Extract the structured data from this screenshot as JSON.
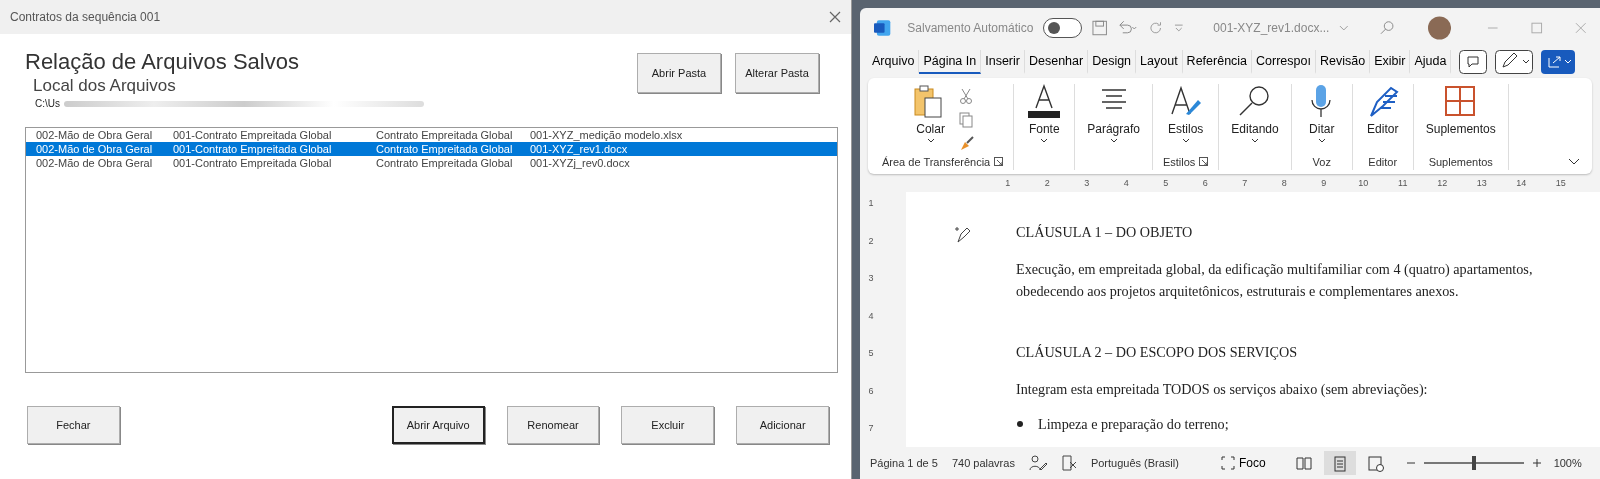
{
  "dialog": {
    "title": "Contratos da sequência 001",
    "heading": "Relação de Arquivos Salvos",
    "subheading": "Local dos Arquivos",
    "path": "C:\\Us",
    "top_buttons": [
      "Abrir Pasta",
      "Alterar Pasta"
    ],
    "files": [
      {
        "cells": [
          "002-Mão de Obra Geral",
          "001-Contrato Empreitada Global",
          "Contrato Empreitada Global",
          "001-XYZ_medição modelo.xlsx"
        ],
        "selected": false
      },
      {
        "cells": [
          "002-Mão de Obra Geral",
          "001-Contrato Empreitada Global",
          "Contrato Empreitada Global",
          "001-XYZ_rev1.docx"
        ],
        "selected": true
      },
      {
        "cells": [
          "002-Mão de Obra Geral",
          "001-Contrato Empreitada Global",
          "Contrato Empreitada Global",
          "001-XYZj_rev0.docx"
        ],
        "selected": false
      }
    ],
    "bottom_buttons": [
      {
        "label": "Fechar",
        "focused": false
      },
      {
        "label": "Abrir Arquivo",
        "focused": true
      },
      {
        "label": "Renomear",
        "focused": false
      },
      {
        "label": "Excluir",
        "focused": false
      },
      {
        "label": "Adicionar",
        "focused": false
      }
    ]
  },
  "word": {
    "autosave_label": "Salvamento Automático",
    "autosave_on": false,
    "doc_title": "001-XYZ_rev1.docx...",
    "tabs": [
      {
        "label": "Arquivo",
        "selected": false
      },
      {
        "label": "Página In",
        "selected": true
      },
      {
        "label": "Inserir",
        "selected": false
      },
      {
        "label": "Desenhar",
        "selected": false
      },
      {
        "label": "Design",
        "selected": false
      },
      {
        "label": "Layout",
        "selected": false
      },
      {
        "label": "Referência",
        "selected": false
      },
      {
        "label": "Correspoı",
        "selected": false
      },
      {
        "label": "Revisão",
        "selected": false
      },
      {
        "label": "Exibir",
        "selected": false
      },
      {
        "label": "Ajuda",
        "selected": false
      }
    ],
    "ribbon_groups": [
      {
        "label": "Área de Transferência",
        "launcher": true,
        "buttons": [
          {
            "label": "Colar",
            "kind": "paste",
            "dropdown": true
          }
        ]
      },
      {
        "buttons": [
          {
            "label": "Fonte",
            "kind": "font",
            "dropdown": true
          }
        ]
      },
      {
        "buttons": [
          {
            "label": "Parágrafo",
            "kind": "paragraph",
            "dropdown": true
          }
        ]
      },
      {
        "label": "Estilos",
        "launcher": true,
        "buttons": [
          {
            "label": "Estilos",
            "kind": "styles",
            "dropdown": true
          }
        ]
      },
      {
        "buttons": [
          {
            "label": "Editando",
            "kind": "search",
            "dropdown": true
          }
        ]
      },
      {
        "label": "Voz",
        "launcher": false,
        "buttons": [
          {
            "label": "Ditar",
            "kind": "mic",
            "dropdown": true
          }
        ]
      },
      {
        "label": "Editor",
        "launcher": false,
        "buttons": [
          {
            "label": "Editor",
            "kind": "pen",
            "dropdown": false
          }
        ]
      },
      {
        "label": "Suplementos",
        "launcher": false,
        "buttons": [
          {
            "label": "Suplementos",
            "kind": "grid",
            "dropdown": false
          }
        ]
      }
    ],
    "ruler_numbers": [
      "1",
      "2",
      "3",
      "4",
      "5",
      "6",
      "7",
      "8",
      "9",
      "10",
      "11",
      "12",
      "13",
      "14",
      "15"
    ],
    "vruler_numbers": [
      "1",
      "2",
      "3",
      "4",
      "5",
      "6",
      "7"
    ],
    "paragraphs": [
      {
        "kind": "heading",
        "text": "CLÁUSULA 1 – DO OBJETO"
      },
      {
        "kind": "body",
        "text": "Execução, em empreitada global, da edificação multifamiliar com 4 (quatro) apartamentos, obedecendo aos projetos arquitetônicos, estruturais e complementares anexos."
      },
      {
        "kind": "heading",
        "text": "CLÁUSULA 2 – DO ESCOPO DOS SERVIÇOS"
      },
      {
        "kind": "body",
        "text": "Integram esta empreitada TODOS os serviços abaixo (sem abreviações):"
      },
      {
        "kind": "bullet",
        "text": "Limpeza e preparação do terreno;"
      }
    ],
    "status": {
      "page": "Página 1 de 5",
      "words": "740 palavras",
      "language": "Português (Brasil)",
      "focus": "Foco",
      "zoom": "100%",
      "level": 0.5,
      "views": [
        {
          "kind": "read",
          "selected": false
        },
        {
          "kind": "print",
          "selected": true
        },
        {
          "kind": "web",
          "selected": false
        }
      ]
    }
  }
}
